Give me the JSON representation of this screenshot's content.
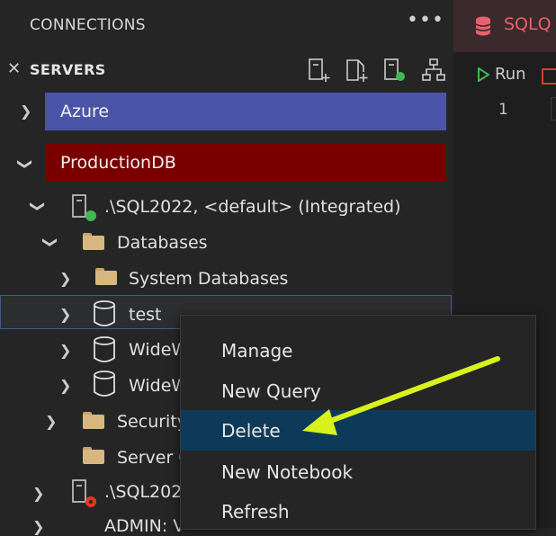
{
  "sidebar": {
    "title": "CONNECTIONS",
    "more": "•••",
    "servers_label": "SERVERS",
    "toolbar": [
      "new-connection-icon",
      "add-server-group-icon",
      "active-connections-icon",
      "tree-view-icon"
    ],
    "groups": [
      {
        "label": "Azure",
        "color": "#4a55a8"
      },
      {
        "label": "ProductionDB",
        "color": "#7a0000"
      }
    ],
    "tree": {
      "server": ".\\SQL2022, <default> (Integrated)",
      "databases": "Databases",
      "system_databases": "System Databases",
      "test": "test",
      "wide1": "WideW",
      "wide2": "WideW",
      "security": "Security",
      "server_objects": "Server O",
      "server2": ".\\SQL2022",
      "admin": "ADMIN: V"
    }
  },
  "editor": {
    "tab_label": "SQLQ",
    "run_label": "Run",
    "line_number": "1"
  },
  "context_menu": {
    "items": [
      "Manage",
      "New Query",
      "Delete",
      "New Notebook",
      "Refresh"
    ],
    "highlighted": "Delete"
  },
  "colors": {
    "highlight": "#0e3a5a",
    "arrow": "#d8f21c",
    "status_connected": "#3fb950",
    "status_error": "#e5391d"
  }
}
